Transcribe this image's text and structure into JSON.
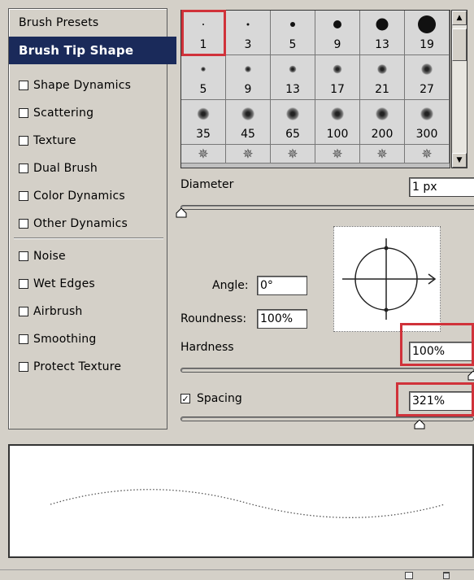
{
  "left_panel": {
    "items": [
      {
        "label": "Brush Presets",
        "type": "header"
      },
      {
        "label": "Brush Tip Shape",
        "type": "selected"
      },
      {
        "label": "Shape Dynamics",
        "type": "check",
        "checked": false
      },
      {
        "label": "Scattering",
        "type": "check",
        "checked": false
      },
      {
        "label": "Texture",
        "type": "check",
        "checked": false
      },
      {
        "label": "Dual Brush",
        "type": "check",
        "checked": false
      },
      {
        "label": "Color Dynamics",
        "type": "check",
        "checked": false
      },
      {
        "label": "Other Dynamics",
        "type": "check",
        "checked": false
      },
      {
        "label": "Noise",
        "type": "check",
        "checked": false
      },
      {
        "label": "Wet Edges",
        "type": "check",
        "checked": false
      },
      {
        "label": "Airbrush",
        "type": "check",
        "checked": false
      },
      {
        "label": "Smoothing",
        "type": "check",
        "checked": false
      },
      {
        "label": "Protect Texture",
        "type": "check",
        "checked": false
      }
    ]
  },
  "brush_grid": {
    "rows": [
      [
        {
          "size": "1",
          "style": "hard"
        },
        {
          "size": "3",
          "style": "hard"
        },
        {
          "size": "5",
          "style": "hard"
        },
        {
          "size": "9",
          "style": "hard"
        },
        {
          "size": "13",
          "style": "hard"
        },
        {
          "size": "19",
          "style": "hard"
        }
      ],
      [
        {
          "size": "5",
          "style": "soft"
        },
        {
          "size": "9",
          "style": "soft"
        },
        {
          "size": "13",
          "style": "soft"
        },
        {
          "size": "17",
          "style": "soft"
        },
        {
          "size": "21",
          "style": "soft"
        },
        {
          "size": "27",
          "style": "soft"
        }
      ],
      [
        {
          "size": "35",
          "style": "soft"
        },
        {
          "size": "45",
          "style": "soft"
        },
        {
          "size": "65",
          "style": "soft"
        },
        {
          "size": "100",
          "style": "soft"
        },
        {
          "size": "200",
          "style": "soft"
        },
        {
          "size": "300",
          "style": "soft"
        }
      ]
    ],
    "selected_size": "1",
    "scroll_up_icon": "scroll-up-arrow",
    "scroll_down_icon": "scroll-down-arrow"
  },
  "diameter": {
    "label": "Diameter",
    "value": "1 px",
    "slider_level": 0
  },
  "angle": {
    "label": "Angle:",
    "value": "0°"
  },
  "roundness": {
    "label": "Roundness:",
    "value": "100%"
  },
  "hardness": {
    "label": "Hardness",
    "value": "100%",
    "slider_level": 1.0
  },
  "spacing": {
    "label": "Spacing",
    "value": "321%",
    "checked": true,
    "slider_level": 0.32
  },
  "colors": {
    "highlight": "#d0323a",
    "selected_bg": "#1a2a5a",
    "panel_bg": "#d4d0c8"
  }
}
